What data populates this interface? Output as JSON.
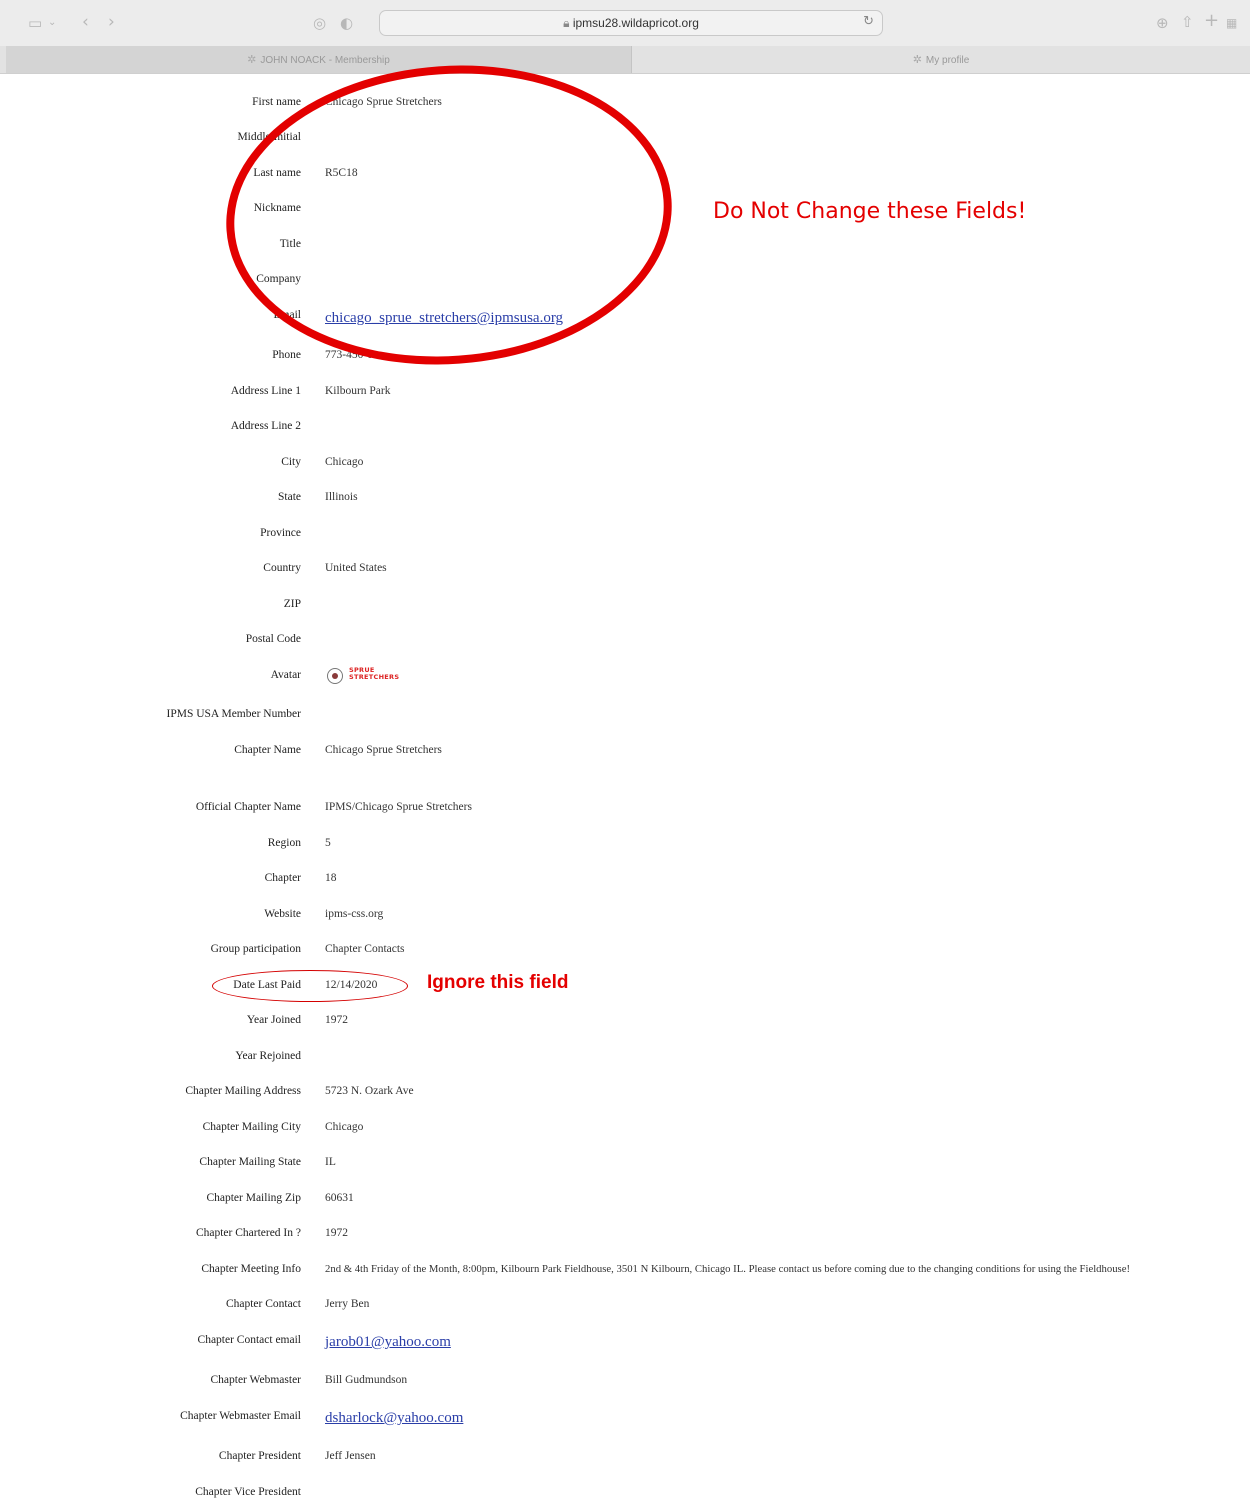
{
  "browser": {
    "url": "ipmsu28.wildapricot.org",
    "icons": [
      "sidebar-icon",
      "chevron-down-icon",
      "back-icon",
      "forward-icon",
      "extension-icon",
      "shield-icon",
      "lock-icon",
      "reload-icon",
      "download-icon",
      "share-icon",
      "new-tab-icon",
      "tab-overview-icon",
      "gear-icon"
    ],
    "tabs": [
      {
        "label": "JOHN NOACK - Membership",
        "active": true
      },
      {
        "label": "My profile",
        "active": false
      }
    ]
  },
  "profile": {
    "fields": [
      {
        "label": "First name",
        "value": "Chicago Sprue Stretchers"
      },
      {
        "label": "Middle Initial",
        "value": ""
      },
      {
        "label": "Last name",
        "value": "R5C18"
      },
      {
        "label": "Nickname",
        "value": ""
      },
      {
        "label": "Title",
        "value": ""
      },
      {
        "label": "Company",
        "value": ""
      },
      {
        "label": "Email",
        "value": "chicago_sprue_stretchers@ipmsusa.org"
      },
      {
        "label": "Phone",
        "value": "773-450-0"
      },
      {
        "label": "Address Line 1",
        "value": "Kilbourn Park"
      },
      {
        "label": "Address Line 2",
        "value": ""
      },
      {
        "label": "City",
        "value": "Chicago"
      },
      {
        "label": "State",
        "value": "Illinois"
      },
      {
        "label": "Province",
        "value": ""
      },
      {
        "label": "Country",
        "value": "United States"
      },
      {
        "label": "ZIP",
        "value": ""
      },
      {
        "label": "Postal Code",
        "value": ""
      },
      {
        "label": "Avatar",
        "value": ""
      },
      {
        "label": "IPMS USA Member Number",
        "value": ""
      },
      {
        "label": "Chapter Name",
        "value": "Chicago Sprue Stretchers"
      },
      {
        "label": "Official Chapter Name",
        "value": "IPMS/Chicago Sprue Stretchers"
      },
      {
        "label": "Region",
        "value": "5"
      },
      {
        "label": "Chapter",
        "value": "18"
      },
      {
        "label": "Website",
        "value": "ipms-css.org"
      },
      {
        "label": "Group participation",
        "value": "Chapter Contacts"
      },
      {
        "label": "Date Last Paid",
        "value": "12/14/2020"
      },
      {
        "label": "Year Joined",
        "value": "1972"
      },
      {
        "label": "Year Rejoined",
        "value": ""
      },
      {
        "label": "Chapter Mailing Address",
        "value": "5723 N. Ozark Ave"
      },
      {
        "label": "Chapter Mailing City",
        "value": "Chicago"
      },
      {
        "label": "Chapter Mailing State",
        "value": "IL"
      },
      {
        "label": "Chapter Mailing Zip",
        "value": "60631"
      },
      {
        "label": "Chapter Chartered In ?",
        "value": "1972"
      },
      {
        "label": "Chapter Meeting Info",
        "value": "2nd & 4th Friday of the Month, 8:00pm, Kilbourn Park Fieldhouse, 3501 N Kilbourn, Chicago IL. Please contact us before coming due to the changing conditions for using the Fieldhouse!"
      },
      {
        "label": "Chapter Contact",
        "value": "Jerry Ben"
      },
      {
        "label": "Chapter Contact email",
        "value": "jarob01@yahoo.com"
      },
      {
        "label": "Chapter Webmaster",
        "value": "Bill Gudmundson"
      },
      {
        "label": "Chapter Webmaster Email",
        "value": "dsharlock@yahoo.com"
      },
      {
        "label": "Chapter President",
        "value": "Jeff Jensen"
      },
      {
        "label": "Chapter Vice President",
        "value": ""
      }
    ],
    "avatar_text": [
      "SPRUE",
      "STRETCHERS"
    ]
  },
  "annotations": {
    "big_note": "Do Not Change these Fields!",
    "small_note": "Ignore this field",
    "color": "#e40000"
  }
}
